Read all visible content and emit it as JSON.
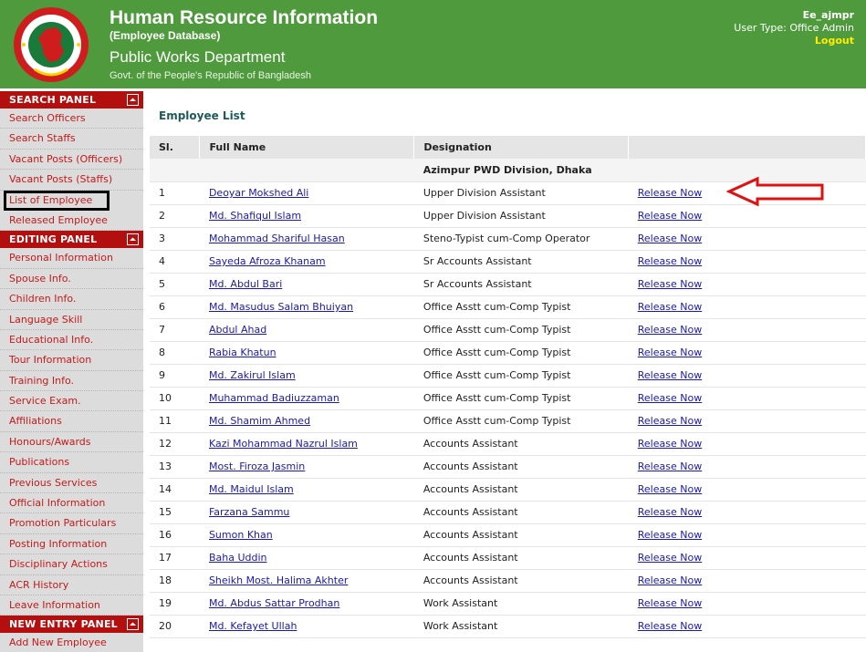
{
  "header": {
    "title": "Human Resource Information",
    "subtitle": "(Employee Database)",
    "department": "Public Works Department",
    "government": "Govt. of the People's Republic of Bangladesh",
    "user_name": "Ee_ajmpr",
    "user_type": "User Type: Office Admin",
    "logout_label": "Logout"
  },
  "sidebar": {
    "search_panel": {
      "title": "SEARCH PANEL",
      "items": [
        "Search Officers",
        "Search Staffs",
        "Vacant Posts (Officers)",
        "Vacant Posts (Staffs)",
        "List of Employee",
        "Released Employee"
      ]
    },
    "editing_panel": {
      "title": "EDITING PANEL",
      "items": [
        "Personal Information",
        "Spouse Info.",
        "Children Info.",
        "Language Skill",
        "Educational Info.",
        "Tour Information",
        "Training Info.",
        "Service Exam.",
        "Affiliations",
        "Honours/Awards",
        "Publications",
        "Previous Services",
        "Official Information",
        "Promotion Particulars",
        "Posting Information",
        "Disciplinary Actions",
        "ACR History",
        "Leave Information"
      ]
    },
    "new_entry_panel": {
      "title": "NEW ENTRY PANEL",
      "items": [
        "Add New Employee"
      ]
    },
    "selected_item": "List of Employee"
  },
  "main": {
    "page_title": "Employee List",
    "columns": [
      "Sl.",
      "Full Name",
      "Designation",
      ""
    ],
    "group_label": "Azimpur PWD Division, Dhaka",
    "action_label": "Release Now",
    "rows": [
      {
        "sl": "1",
        "name": "Deoyar Mokshed Ali",
        "designation": "Upper Division Assistant"
      },
      {
        "sl": "2",
        "name": "Md. Shafiqul Islam",
        "designation": "Upper Division Assistant"
      },
      {
        "sl": "3",
        "name": "Mohammad Shariful Hasan",
        "designation": "Steno-Typist cum-Comp Operator"
      },
      {
        "sl": "4",
        "name": "Sayeda Afroza Khanam",
        "designation": "Sr Accounts Assistant"
      },
      {
        "sl": "5",
        "name": "Md. Abdul Bari",
        "designation": "Sr Accounts Assistant"
      },
      {
        "sl": "6",
        "name": "Md. Masudus Salam Bhuiyan",
        "designation": "Office Asstt cum-Comp Typist"
      },
      {
        "sl": "7",
        "name": "Abdul Ahad",
        "designation": "Office Asstt cum-Comp Typist"
      },
      {
        "sl": "8",
        "name": "Rabia Khatun",
        "designation": "Office Asstt cum-Comp Typist"
      },
      {
        "sl": "9",
        "name": "Md. Zakirul Islam",
        "designation": "Office Asstt cum-Comp Typist"
      },
      {
        "sl": "10",
        "name": "Muhammad Badiuzzaman",
        "designation": "Office Asstt cum-Comp Typist"
      },
      {
        "sl": "11",
        "name": "Md. Shamim Ahmed",
        "designation": "Office Asstt cum-Comp Typist"
      },
      {
        "sl": "12",
        "name": "Kazi Mohammad Nazrul Islam",
        "designation": "Accounts Assistant"
      },
      {
        "sl": "13",
        "name": "Most. Firoza Jasmin",
        "designation": "Accounts Assistant"
      },
      {
        "sl": "14",
        "name": "Md. Maidul Islam",
        "designation": "Accounts Assistant"
      },
      {
        "sl": "15",
        "name": "Farzana Sammu",
        "designation": "Accounts Assistant"
      },
      {
        "sl": "16",
        "name": "Sumon Khan",
        "designation": "Accounts Assistant"
      },
      {
        "sl": "17",
        "name": "Baha Uddin",
        "designation": "Accounts Assistant"
      },
      {
        "sl": "18",
        "name": "Sheikh Most. Halima Akhter",
        "designation": "Accounts Assistant"
      },
      {
        "sl": "19",
        "name": "Md. Abdus Sattar Prodhan",
        "designation": "Work Assistant"
      },
      {
        "sl": "20",
        "name": "Md. Kefayet Ullah",
        "designation": "Work Assistant"
      }
    ]
  },
  "icons": {
    "logo": "government-seal-icon",
    "collapse": "collapse-toggle-icon",
    "annotation": "red-arrow-icon"
  },
  "colors": {
    "header_bg": "#4e9a3c",
    "panel_head_bg": "#b30f0f",
    "nav_text": "#c41a1a",
    "link": "#1a1aa8",
    "logout": "#ffee00",
    "arrow": "#e01010"
  }
}
